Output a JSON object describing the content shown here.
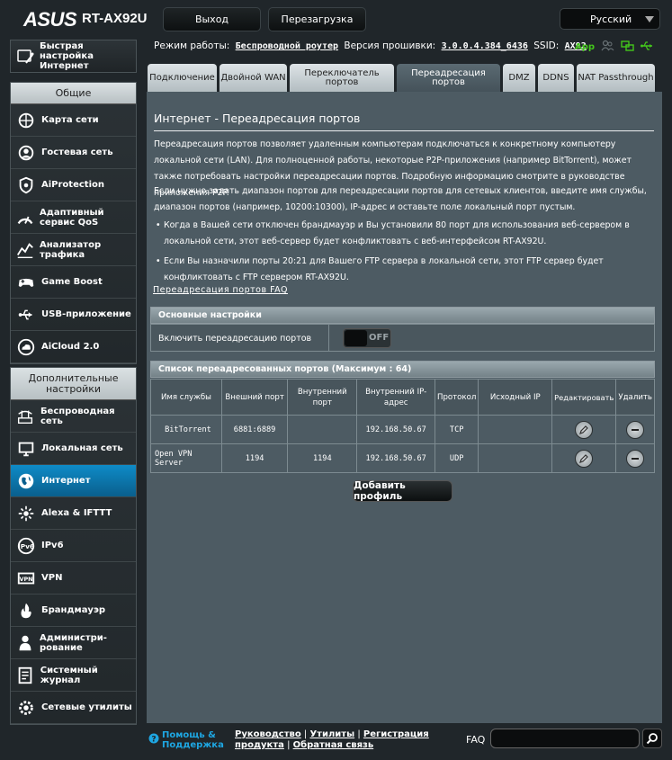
{
  "brand": {
    "logo": "ASUS",
    "model": "RT-AX92U"
  },
  "header": {
    "logout_label": "Выход",
    "reboot_label": "Перезагрузка",
    "language": "Русский"
  },
  "status": {
    "mode_label": "Режим работы:",
    "mode_value": "Беспроводной роутер",
    "firmware_label": "Версия прошивки:",
    "firmware_value": "3.0.0.4.384_6436",
    "ssid_label": "SSID:",
    "ssid_value": "AX92",
    "app_label": "App"
  },
  "sidebar": {
    "quick_setup": "Быстрая настройка Интернет",
    "general_header": "Общие",
    "general_items": [
      {
        "label": "Карта сети",
        "icon": "network-map-icon"
      },
      {
        "label": "Гостевая сеть",
        "icon": "guest-network-icon"
      },
      {
        "label": "AiProtection",
        "icon": "aiprotection-icon"
      },
      {
        "label": "Адаптивный сервис QoS",
        "icon": "qos-icon"
      },
      {
        "label": "Анализатор трафика",
        "icon": "traffic-analyzer-icon"
      },
      {
        "label": "Game Boost",
        "icon": "gamepad-icon"
      },
      {
        "label": "USB-приложение",
        "icon": "usb-icon"
      },
      {
        "label": "AiCloud 2.0",
        "icon": "cloud-icon"
      }
    ],
    "advanced_header": "Дополнительные настройки",
    "advanced_items": [
      {
        "label": "Беспроводная сеть",
        "icon": "wireless-icon"
      },
      {
        "label": "Локальная сеть",
        "icon": "lan-icon"
      },
      {
        "label": "Интернет",
        "icon": "globe-icon"
      },
      {
        "label": "Alexa & IFTTT",
        "icon": "alexa-icon"
      },
      {
        "label": "IPv6",
        "icon": "ipv6-icon"
      },
      {
        "label": "VPN",
        "icon": "vpn-icon"
      },
      {
        "label": "Брандмауэр",
        "icon": "firewall-icon"
      },
      {
        "label": "Администри-рование",
        "icon": "administration-icon"
      },
      {
        "label": "Системный журнал",
        "icon": "system-log-icon"
      },
      {
        "label": "Сетевые утилиты",
        "icon": "network-tools-icon"
      }
    ],
    "active_item": "Интернет"
  },
  "tabs": [
    {
      "label": "Подключение"
    },
    {
      "label": "Двойной WAN"
    },
    {
      "label": "Переключатель портов"
    },
    {
      "label": "Переадресация портов"
    },
    {
      "label": "DMZ"
    },
    {
      "label": "DDNS"
    },
    {
      "label": "NAT Passthrough"
    }
  ],
  "main": {
    "title": "Интернет - Переадресация портов",
    "intro_1": "Переадресация портов позволяет удаленным компьютерам подключаться к конкретному компьютеру локальной сети (LAN). Для полноценной работы, некоторые P2P-приложения (например BitTorrent), может также потребовать настройки переадресации портов. Подробную информацию смотрите в руководстве приложения P2P.",
    "intro_2": "Если нужно задать диапазон портов для переадресации портов для сетевых клиентов, введите имя службы, диапазон портов (например, 10200:10300), IP-адрес и оставьте поле локальный порт пустым.",
    "bullet_1": "Когда в Вашей сети отключен брандмауэр и Вы установили 80 порт для использования веб-сервером в локальной сети, этот веб-сервер будет конфликтовать с веб-интерфейсом RT-AX92U.",
    "bullet_2": "Если Вы назначили порты 20:21 для Вашего FTP сервера в локальной сети, этот FTP сервер будет конфликтовать с FTP сервером RT-AX92U.",
    "faq_link": "Переадресация портов FAQ",
    "basic_header": "Основные настройки",
    "enable_label": "Включить переадресацию портов",
    "toggle_state": "OFF",
    "list_header": "Список переадресованных портов (Максимум : 64)",
    "columns": [
      "Имя службы",
      "Внешний порт",
      "Внутренний порт",
      "Внутренний IP-адрес",
      "Протокол",
      "Исходный IP",
      "Редактировать",
      "Удалить"
    ],
    "rows": [
      {
        "service": "BitTorrent",
        "ext_port": "6881:6889",
        "int_port": "",
        "ip": "192.168.50.67",
        "proto": "TCP",
        "src_ip": ""
      },
      {
        "service": "Open VPN Server",
        "ext_port": "1194",
        "int_port": "1194",
        "ip": "192.168.50.67",
        "proto": "UDP",
        "src_ip": ""
      }
    ],
    "add_label": "Добавить профиль"
  },
  "footer": {
    "help_1": "Помощь &",
    "help_2": "Поддержка",
    "link_manual": "Руководство",
    "link_utils": "Утилиты",
    "link_reg_1": "Регистрация",
    "link_reg_2": "продукта",
    "link_feedback": "Обратная связь",
    "sep": "|",
    "faq_label": "FAQ",
    "search_value": ""
  }
}
